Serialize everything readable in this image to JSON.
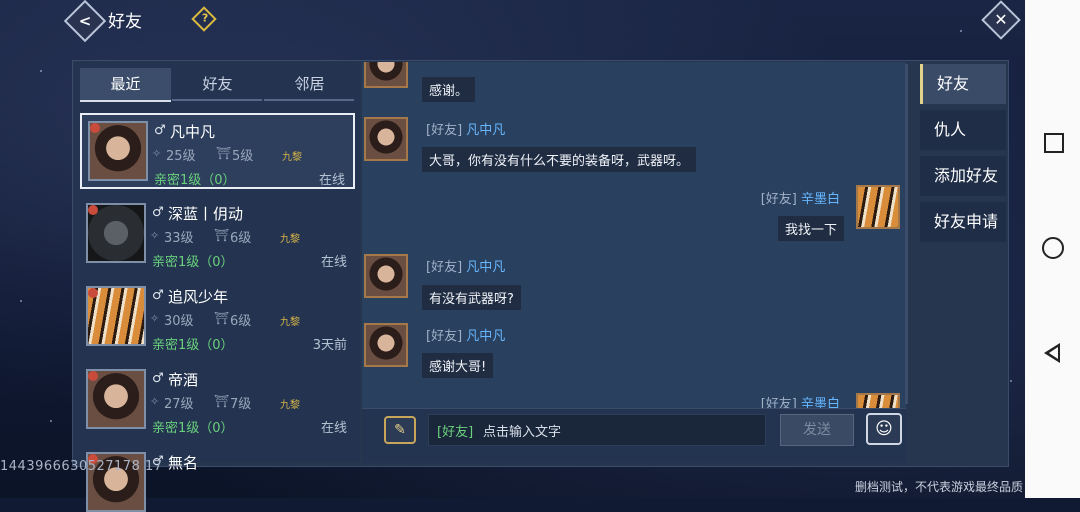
{
  "header": {
    "title": "好友",
    "help_glyph": "?",
    "back_glyph": "<",
    "close_glyph": "✕"
  },
  "tabs": [
    {
      "label": "最近",
      "active": true
    },
    {
      "label": "好友",
      "active": false
    },
    {
      "label": "邻居",
      "active": false
    }
  ],
  "friends": [
    {
      "gender": "♂",
      "name": "凡中凡",
      "level": "25级",
      "rank": "5级",
      "guild": "九黎",
      "intimacy": "亲密1级（0）",
      "status": "在线",
      "avatar": "human",
      "selected": true
    },
    {
      "gender": "♂",
      "name": "深蓝丨仴动",
      "level": "33级",
      "rank": "6级",
      "guild": "九黎",
      "intimacy": "亲密1级（0）",
      "status": "在线",
      "avatar": "wolf",
      "selected": false
    },
    {
      "gender": "♂",
      "name": "追风少年",
      "level": "30级",
      "rank": "6级",
      "guild": "九黎",
      "intimacy": "亲密1级（0）",
      "status": "3天前",
      "avatar": "tiger",
      "selected": false
    },
    {
      "gender": "♂",
      "name": "帝酒",
      "level": "27级",
      "rank": "7级",
      "guild": "九黎",
      "intimacy": "亲密1级（0）",
      "status": "在线",
      "avatar": "human",
      "selected": false
    },
    {
      "gender": "♂",
      "name": "無名",
      "level": "",
      "rank": "",
      "guild": "",
      "intimacy": "",
      "status": "",
      "avatar": "human",
      "selected": false
    }
  ],
  "user_id": "1443966630527178 17",
  "messages": [
    {
      "side": "left",
      "channel": "",
      "name": "",
      "text": "感谢。",
      "avatar": "human"
    },
    {
      "side": "left",
      "channel": "[好友]",
      "name": "凡中凡",
      "text": "大哥，你有没有什么不要的装备呀，武器呀。",
      "avatar": "human"
    },
    {
      "side": "right",
      "channel": "[好友]",
      "name": "辛墨白",
      "text": "我找一下",
      "avatar": "tiger"
    },
    {
      "side": "left",
      "channel": "[好友]",
      "name": "凡中凡",
      "text": "有没有武器呀?",
      "avatar": "human"
    },
    {
      "side": "left",
      "channel": "[好友]",
      "name": "凡中凡",
      "text": "感谢大哥!",
      "avatar": "human"
    },
    {
      "side": "right",
      "channel": "[好友]",
      "name": "辛墨白",
      "text": "",
      "avatar": "tiger"
    }
  ],
  "input": {
    "channel": "[好友]",
    "placeholder": "点击输入文字",
    "send_label": "发送",
    "voice_glyph": "✎",
    "emoji_glyph": "☺"
  },
  "right_tabs": [
    {
      "label": "好友",
      "active": true
    },
    {
      "label": "仇人",
      "active": false
    },
    {
      "label": "添加好友",
      "active": false
    },
    {
      "label": "好友申请",
      "active": false
    }
  ],
  "footer": "删档测试，不代表游戏最终品质",
  "colors": {
    "panel": "#26364f",
    "intimacy": "#69d07c",
    "name_link": "#67b6ff",
    "guild": "#d6b347"
  }
}
